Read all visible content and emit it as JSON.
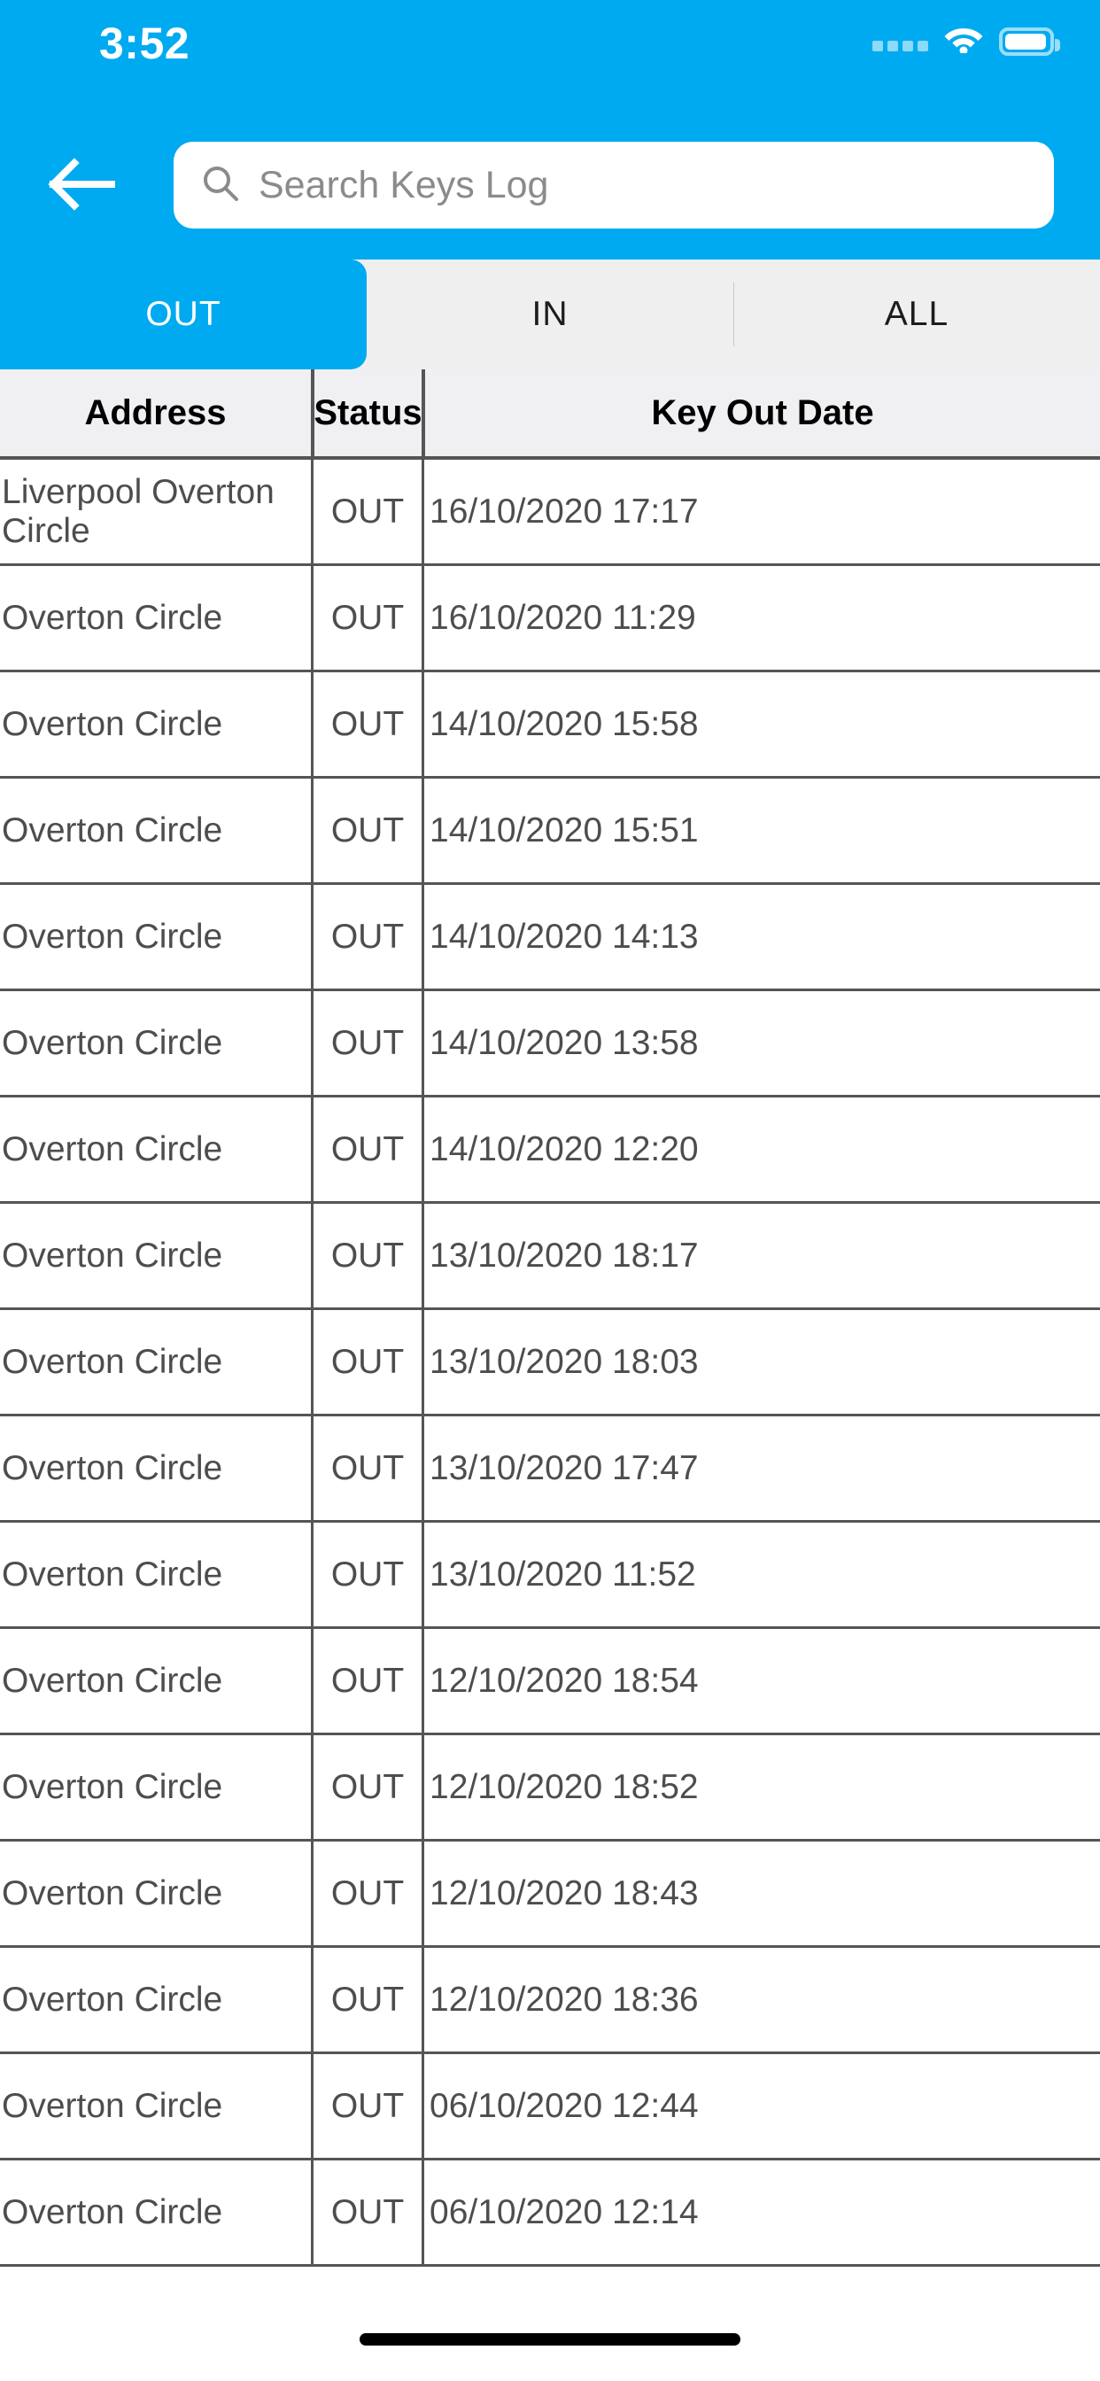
{
  "status_bar": {
    "time": "3:52",
    "signal_icon": "cellular-signal-dots",
    "wifi_icon": "wifi-icon",
    "battery_icon": "battery-full-icon"
  },
  "header": {
    "back_icon": "back-arrow-icon",
    "search": {
      "icon": "search-icon",
      "placeholder": "Search Keys Log",
      "value": ""
    },
    "background_color": "#00AAF0"
  },
  "tabs": {
    "active_index": 0,
    "items": [
      {
        "label": "OUT"
      },
      {
        "label": "IN"
      },
      {
        "label": "ALL"
      }
    ],
    "active_color": "#00AAF0",
    "inactive_background": "#EFEFEF"
  },
  "table": {
    "columns": [
      "Address",
      "Status",
      "Key Out Date"
    ],
    "rows": [
      {
        "address": "Liverpool Overton Circle",
        "status": "OUT",
        "date": "16/10/2020 17:17"
      },
      {
        "address": "Overton Circle",
        "status": "OUT",
        "date": "16/10/2020 11:29"
      },
      {
        "address": "Overton Circle",
        "status": "OUT",
        "date": "14/10/2020 15:58"
      },
      {
        "address": "Overton Circle",
        "status": "OUT",
        "date": "14/10/2020 15:51"
      },
      {
        "address": "Overton Circle",
        "status": "OUT",
        "date": "14/10/2020 14:13"
      },
      {
        "address": "Overton Circle",
        "status": "OUT",
        "date": "14/10/2020 13:58"
      },
      {
        "address": "Overton Circle",
        "status": "OUT",
        "date": "14/10/2020 12:20"
      },
      {
        "address": "Overton Circle",
        "status": "OUT",
        "date": "13/10/2020 18:17"
      },
      {
        "address": "Overton Circle",
        "status": "OUT",
        "date": "13/10/2020 18:03"
      },
      {
        "address": "Overton Circle",
        "status": "OUT",
        "date": "13/10/2020 17:47"
      },
      {
        "address": "Overton Circle",
        "status": "OUT",
        "date": "13/10/2020 11:52"
      },
      {
        "address": "Overton Circle",
        "status": "OUT",
        "date": "12/10/2020 18:54"
      },
      {
        "address": "Overton Circle",
        "status": "OUT",
        "date": "12/10/2020 18:52"
      },
      {
        "address": "Overton Circle",
        "status": "OUT",
        "date": "12/10/2020 18:43"
      },
      {
        "address": "Overton Circle",
        "status": "OUT",
        "date": "12/10/2020 18:36"
      },
      {
        "address": "Overton Circle",
        "status": "OUT",
        "date": "06/10/2020 12:44"
      },
      {
        "address": "Overton Circle",
        "status": "OUT",
        "date": "06/10/2020 12:14"
      }
    ]
  },
  "home_indicator": {
    "name": "home-indicator"
  }
}
